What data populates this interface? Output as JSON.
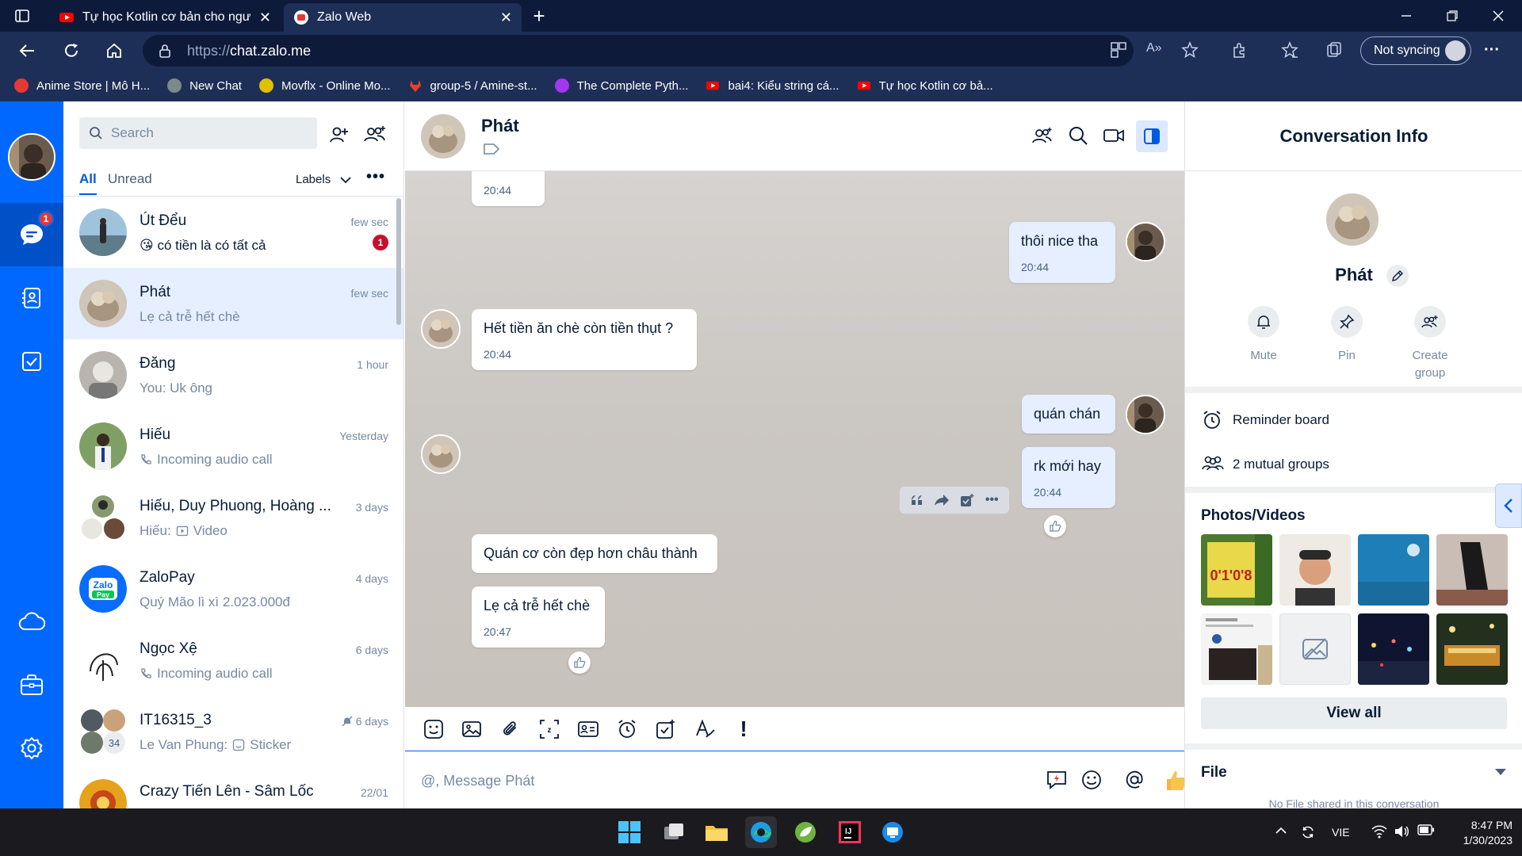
{
  "browser": {
    "tabs": [
      {
        "title": "Tự học Kotlin cơ bản cho người mới",
        "favicon": "youtube-icon",
        "color": "#ff0000"
      },
      {
        "title": "Zalo Web",
        "favicon": "zalo-icon",
        "color": "#e53935",
        "active": true
      }
    ],
    "url_scheme": "https://",
    "url_host": "chat.zalo.me",
    "sync_label": "Not syncing",
    "bookmarks": [
      {
        "label": "Anime Store | Mô H...",
        "icon": "anime-store-icon",
        "color": "#e53935"
      },
      {
        "label": "New Chat",
        "icon": "chatgpt-icon",
        "color": "#7a8a8a"
      },
      {
        "label": "Movflx - Online Mo...",
        "icon": "movflx-icon",
        "color": "#e0c000"
      },
      {
        "label": "group-5 / Amine-st...",
        "icon": "gitlab-icon",
        "color": "#e24329"
      },
      {
        "label": "The Complete Pyth...",
        "icon": "udemy-icon",
        "color": "#a435f0"
      },
      {
        "label": "bai4: Kiểu string cá...",
        "icon": "youtube-icon",
        "color": "#ff0000"
      },
      {
        "label": "Tự học Kotlin cơ bả...",
        "icon": "youtube-icon",
        "color": "#ff0000"
      }
    ]
  },
  "nav": {
    "messages_badge": "1"
  },
  "conversations": {
    "search_placeholder": "Search",
    "tab_all": "All",
    "tab_unread": "Unread",
    "labels": "Labels",
    "more": "•••",
    "items": [
      {
        "name": "Út Đểu",
        "time": "few sec",
        "preview": "😘 có tiền là có tất cả",
        "unread": "1",
        "bold": true
      },
      {
        "name": "Phát",
        "time": "few sec",
        "preview": "Lẹ cả trễ hết chè",
        "active": true
      },
      {
        "name": "Đăng",
        "time": "1 hour",
        "preview": "You: Uk ông"
      },
      {
        "name": "Hiếu",
        "time": "Yesterday",
        "preview": "Incoming audio call",
        "icon": "phone-icon"
      },
      {
        "name": "Hiếu, Duy Phuong, Hoàng ...",
        "time": "3 days",
        "preview_prefix": "Hiếu:",
        "preview": "Video",
        "icon": "video-icon"
      },
      {
        "name": "ZaloPay",
        "time": "4 days",
        "preview": "Quý Mão lì xì 2.023.000đ"
      },
      {
        "name": "Ngọc Xệ",
        "time": "6 days",
        "preview": "Incoming audio call",
        "icon": "phone-icon"
      },
      {
        "name": "IT16315_3",
        "time": "6 days",
        "preview_prefix": "Le Van Phung:",
        "preview": "Sticker",
        "icon": "sticker-icon",
        "group_count": "34",
        "muted": true
      },
      {
        "name": "Crazy Tiến Lên - Sâm Lốc",
        "time": "22/01",
        "preview": ""
      }
    ]
  },
  "chat": {
    "title": "Phát",
    "messages": [
      {
        "text": "",
        "time": "20:44",
        "mine": false
      },
      {
        "text": "thôi nice tha",
        "time": "20:44",
        "mine": true
      },
      {
        "text": "Hết tiền ăn chè còn tiền thụt ?",
        "time": "20:44",
        "mine": false
      },
      {
        "text": "quán chán",
        "time": "",
        "mine": true
      },
      {
        "text": "rk mới hay",
        "time": "20:44",
        "mine": true
      },
      {
        "text": "Quán cơ còn đẹp hơn châu thành",
        "time": "",
        "mine": false
      },
      {
        "text": "Lẹ cả trễ hết chè",
        "time": "20:47",
        "mine": false
      }
    ],
    "input_placeholder": "@, Message Phát",
    "toolbar_important": "!"
  },
  "info": {
    "header": "Conversation Info",
    "name": "Phát",
    "actions": [
      {
        "label": "Mute",
        "icon": "bell-icon"
      },
      {
        "label": "Pin",
        "icon": "pin-icon"
      },
      {
        "label": "Create group",
        "icon": "add-group-icon"
      }
    ],
    "reminder_board": "Reminder board",
    "mutual_groups": "2 mutual groups",
    "media_title": "Photos/Videos",
    "view_all": "View all",
    "file_title": "File",
    "no_file": "No File shared in this conversation"
  },
  "taskbar": {
    "language": "VIE",
    "time": "8:47 PM",
    "date": "1/30/2023"
  },
  "colors": {
    "zalo_blue": "#0068ff",
    "accent": "#005ae0",
    "my_bubble": "#e5efff",
    "badge_red": "#c8102e"
  }
}
